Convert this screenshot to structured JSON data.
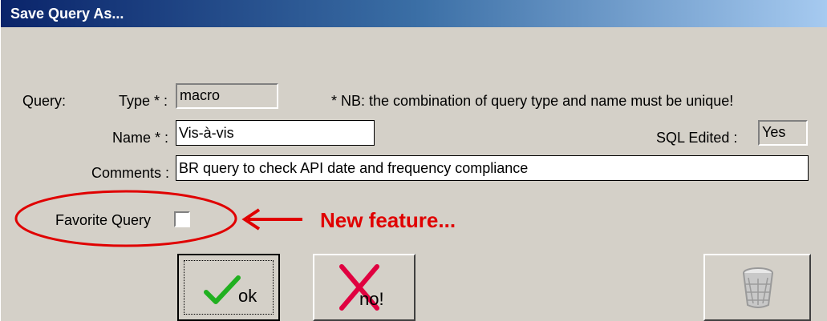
{
  "window": {
    "title": "Save Query As..."
  },
  "form": {
    "query_label": "Query:",
    "type_label": "Type * :",
    "type_value": "macro",
    "note": "* NB:  the combination of query type and name must be unique!",
    "name_label": "Name * :",
    "name_value": "Vis-à-vis",
    "sql_edited_label": "SQL Edited :",
    "sql_edited_value": "Yes",
    "comments_label": "Comments :",
    "comments_value": "BR query to check API date and frequency compliance",
    "favorite_label": "Favorite Query"
  },
  "annotation": {
    "text": "New feature...",
    "color": "#e00000"
  },
  "buttons": {
    "ok_label": "ok",
    "no_label": "no!",
    "delete_icon": "trash-bin-icon"
  }
}
